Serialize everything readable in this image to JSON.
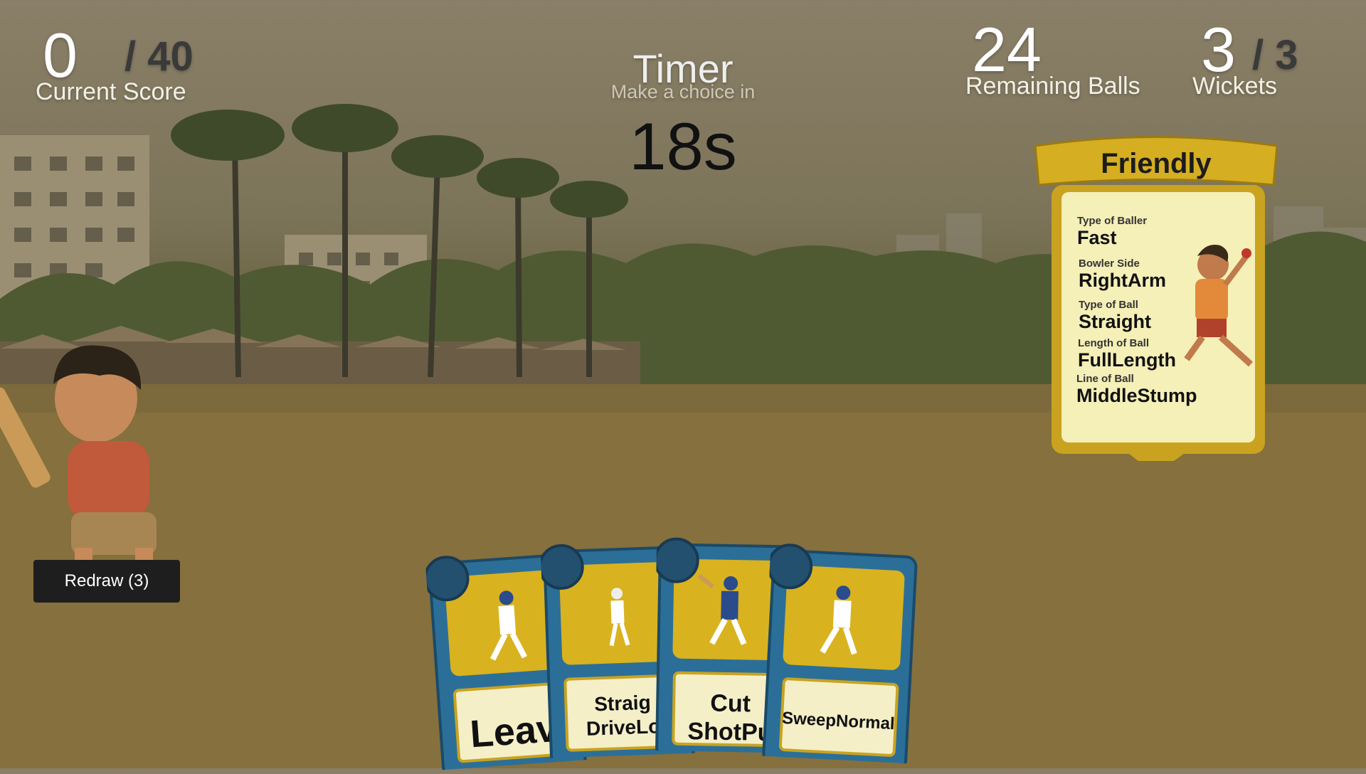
{
  "score": {
    "value": "0",
    "max": "/ 40",
    "label": "Current Score"
  },
  "timer": {
    "title": "Timer",
    "subtitle": "Make a choice in",
    "value": "18s"
  },
  "balls": {
    "value": "24",
    "label": "Remaining Balls"
  },
  "wickets": {
    "value": "3",
    "max": "/ 3",
    "label": "Wickets"
  },
  "bowler_card": {
    "title": "Friendly",
    "fields": [
      {
        "label": "Type of Baller",
        "value": "Fast"
      },
      {
        "label": "Bowler Side",
        "value": "RightArm"
      },
      {
        "label": "Type of Ball",
        "value": "Straight"
      },
      {
        "label": "Length of Ball",
        "value": "FullLength"
      },
      {
        "label": "Line of Ball",
        "value": "MiddleStump"
      }
    ]
  },
  "redraw": {
    "label": "Redraw (3)"
  },
  "hand": [
    {
      "name": "Leav"
    },
    {
      "name1": "Straig",
      "name2": "DriveLo"
    },
    {
      "name1": "Cut",
      "name2": "ShotPu"
    },
    {
      "name": "SweepNormal"
    }
  ],
  "colors": {
    "card_blue": "#2b6f98",
    "card_gold": "#d9b21f",
    "panel_cream": "#f5efb8",
    "button_dark": "#1e1e1e"
  }
}
